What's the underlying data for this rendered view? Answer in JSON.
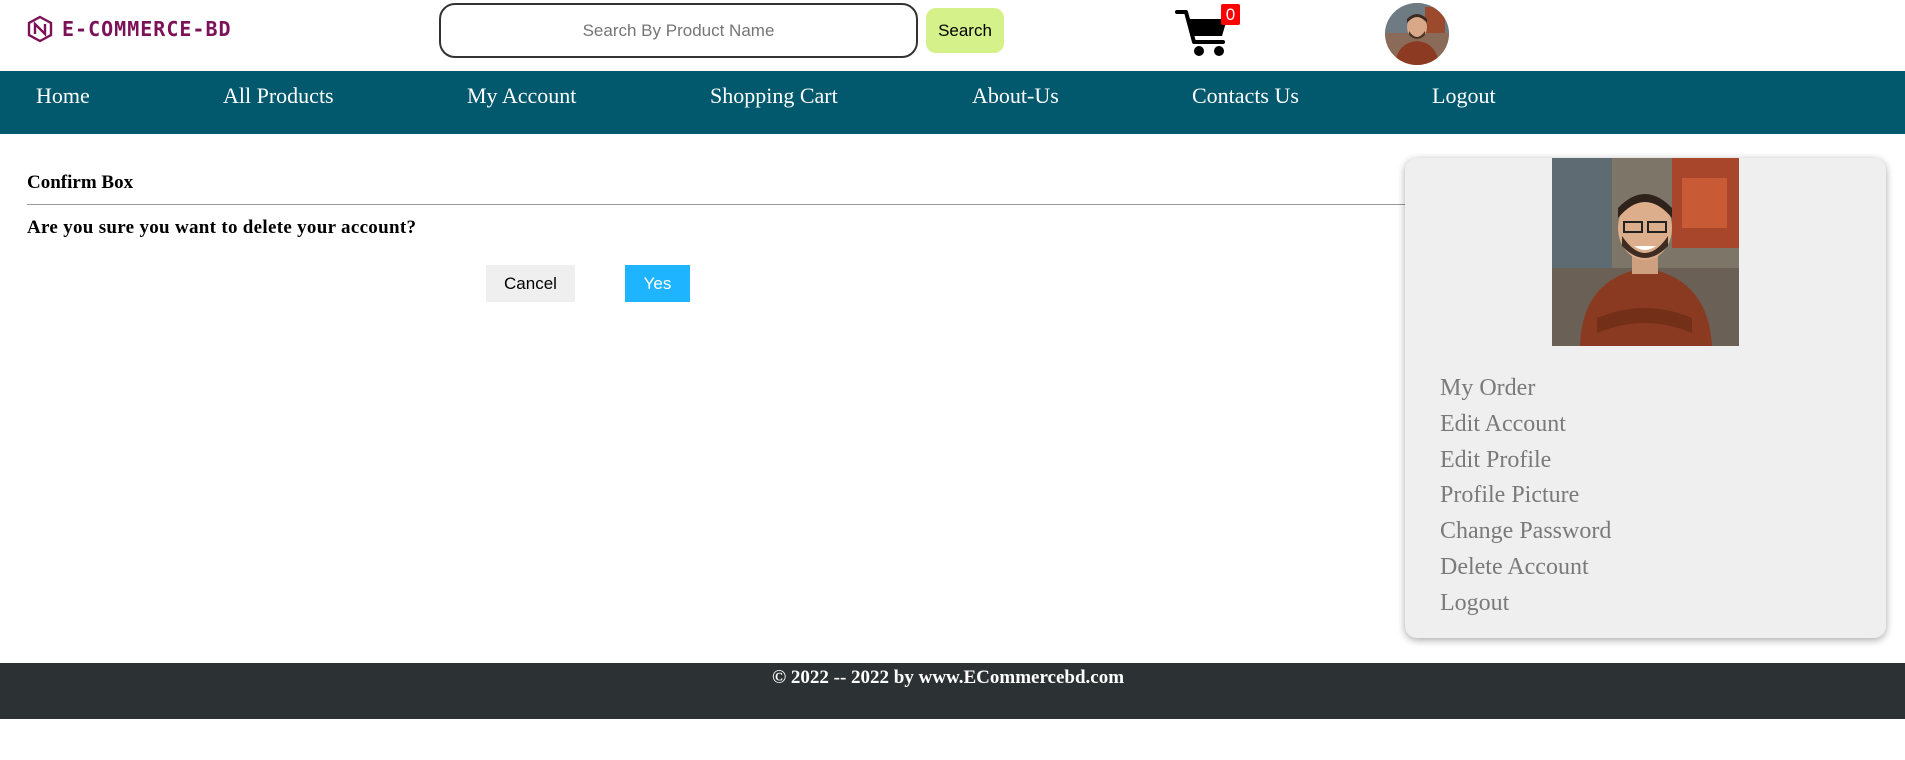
{
  "brand": {
    "name": "E-COMMERCE-BD",
    "color": "#7b1257"
  },
  "search": {
    "placeholder": "Search By Product Name",
    "value": "",
    "button_label": "Search"
  },
  "cart": {
    "count": "0"
  },
  "nav": {
    "items": [
      {
        "label": "Home"
      },
      {
        "label": "All Products"
      },
      {
        "label": "My Account"
      },
      {
        "label": "Shopping Cart"
      },
      {
        "label": "About-Us"
      },
      {
        "label": "Contacts Us"
      },
      {
        "label": "Logout"
      }
    ]
  },
  "confirm": {
    "title": "Confirm Box",
    "message": "Are you sure you want to delete your account?",
    "cancel_label": "Cancel",
    "yes_label": "Yes"
  },
  "account_menu": {
    "items": [
      {
        "label": "My Order"
      },
      {
        "label": "Edit Account"
      },
      {
        "label": "Edit Profile"
      },
      {
        "label": "Profile Picture"
      },
      {
        "label": "Change Password"
      },
      {
        "label": "Delete Account"
      },
      {
        "label": "Logout"
      }
    ]
  },
  "footer": {
    "text": "© 2022 -- 2022 by www.ECommercebd.com"
  },
  "colors": {
    "nav_bg": "#02586d",
    "search_button": "#d4f18a",
    "yes_button": "#1eb4ff",
    "cart_badge": "#ff0000",
    "footer_bg": "#2c3233"
  }
}
